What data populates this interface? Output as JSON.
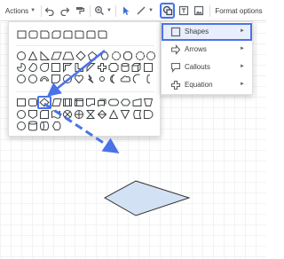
{
  "toolbar": {
    "actions_label": "Actions",
    "format_options_label": "Format options",
    "buttons": [
      {
        "icon": "undo-icon"
      },
      {
        "icon": "redo-icon"
      },
      {
        "icon": "paint-format-icon"
      },
      {
        "icon": "zoom-icon"
      },
      {
        "icon": "select-arrow-icon"
      },
      {
        "icon": "line-icon"
      },
      {
        "icon": "shape-icon",
        "active": true
      },
      {
        "icon": "text-box-icon"
      },
      {
        "icon": "image-icon"
      }
    ],
    "accent_color": "#4a73e8"
  },
  "shape_menu": {
    "items": [
      {
        "label": "Shapes",
        "icon": "square-icon",
        "selected": true
      },
      {
        "label": "Arrows",
        "icon": "arrow-right-icon"
      },
      {
        "label": "Callouts",
        "icon": "callout-icon"
      },
      {
        "label": "Equation",
        "icon": "plus-icon"
      }
    ]
  },
  "shapes_panel": {
    "rows": [
      [
        "rectangle",
        "rounded-rectangle",
        "snip-corner",
        "snip-diagonal",
        "snip-round",
        "round-single-corner",
        "round-same-side",
        "round-diagonal"
      ],
      [
        "oval",
        "triangle",
        "right-triangle",
        "parallelogram",
        "trapezoid",
        "diamond",
        "pentagon",
        "hexagon",
        "heptagon",
        "octagon",
        "decagon",
        "dodecagon"
      ],
      [
        "pie",
        "chord",
        "teardrop",
        "frame",
        "half-frame",
        "l-shape",
        "diagonal-stripe",
        "cross",
        "plaque",
        "can",
        "cube",
        "bevel"
      ],
      [
        "donut",
        "no-symbol",
        "block-arc",
        "folded-corner",
        "smiley",
        "heart",
        "lightning",
        "sun",
        "moon",
        "cloud",
        "arc",
        "bracket"
      ],
      [
        "flow-process",
        "flow-alternate",
        "flow-decision",
        "flow-data",
        "flow-predefined",
        "flow-internal-storage",
        "flow-document",
        "flow-multidocument",
        "flow-terminator",
        "flow-preparation",
        "flow-manual-input",
        "flow-manual-operation"
      ],
      [
        "flow-connector",
        "flow-offpage",
        "flow-card",
        "flow-punched-tape",
        "flow-summing",
        "flow-or",
        "flow-collate",
        "flow-sort",
        "flow-extract",
        "flow-merge",
        "flow-stored-data",
        "flow-delay"
      ],
      [
        "flow-sequential",
        "flow-magnetic-disk",
        "flow-direct-access",
        "flow-display"
      ]
    ],
    "highlighted_shape": "flow-decision"
  },
  "canvas": {
    "drawn_shape": "diamond",
    "fill_color": "#d3e1f4",
    "stroke_color": "#333333",
    "annotation_color": "#4a73e8"
  }
}
